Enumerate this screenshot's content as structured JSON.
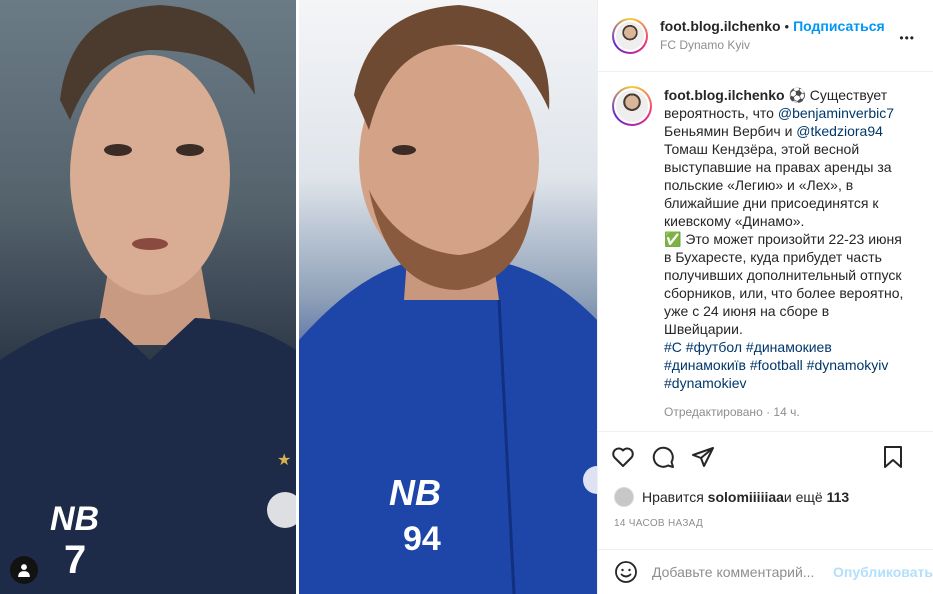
{
  "post": {
    "username": "foot.blog.ilchenko",
    "follow_label": "Подписаться",
    "location": "FC Dynamo Kyiv",
    "more_label": "•••"
  },
  "caption": {
    "username": "foot.blog.ilchenko",
    "emoji_ball": "⚽",
    "text_1": " Существует вероятность, что ",
    "mention_1": "@benjaminverbic7",
    "text_2": " Беньямин Вербич и ",
    "mention_2": "@tkedziora94",
    "text_3": " Томаш Кендзёра, этой весной выступавшие на правах аренды за польские «Легию» и «Лех», в ближайшие дни присоединятся к киевскому «Динамо».",
    "check_emoji": "✅",
    "text_4": " Это может произойти 22-23 июня в Бухаресте, куда прибудет часть получивших дополнительный отпуск сборников, или, что более вероятно, уже с 24 июня на сборе в Швейцарии.",
    "hashtags": "#С #футбол #динамокиев #динамокиїв #football #dynamokyiv #dynamokiev",
    "edited": "Отредактировано · 14 ч."
  },
  "engagement": {
    "liked_by_prefix": "Нравится ",
    "liked_by_user": "solomiiiiiaa",
    "liked_by_suffix": " и ещё ",
    "liked_count": "113",
    "timestamp": "14 ЧАСОВ НАЗАД"
  },
  "comment": {
    "placeholder": "Добавьте комментарий...",
    "publish_label": "Опубликовать"
  },
  "media": {
    "left_jersey_number": "7",
    "right_jersey_number": "94"
  },
  "colors": {
    "accent": "#0095f6",
    "publish_disabled": "#b2dffc",
    "muted": "#8e8e8e",
    "mention": "#00376b"
  },
  "icons": [
    "user-tag-icon",
    "heart-icon",
    "comment-icon",
    "share-icon",
    "bookmark-icon",
    "emoji-icon",
    "more-icon"
  ]
}
